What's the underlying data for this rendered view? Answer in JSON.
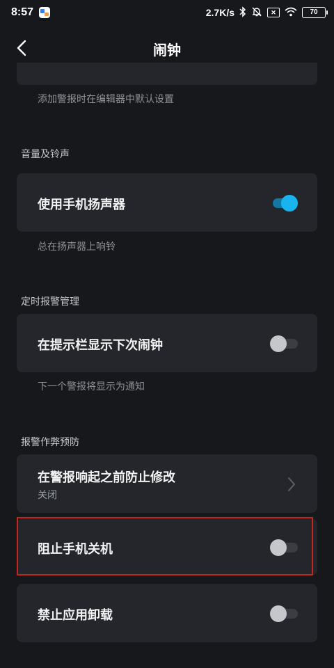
{
  "status_bar": {
    "time": "8:57",
    "network_speed": "2.7K/s",
    "battery": "70",
    "icons": [
      "app-icon",
      "bluetooth-icon",
      "mute-bell-icon",
      "sim-off-icon",
      "wifi-icon",
      "battery-icon"
    ]
  },
  "header": {
    "title": "闹钟",
    "back_icon": "chevron-left-icon"
  },
  "top_hint": "添加警报时在编辑器中默认设置",
  "sections": [
    {
      "title": "音量及铃声",
      "rows": [
        {
          "label": "使用手机扬声器",
          "hint": "总在扬声器上响铃",
          "toggle": "on"
        }
      ]
    },
    {
      "title": "定时报警管理",
      "rows": [
        {
          "label": "在提示栏显示下次闹钟",
          "hint": "下一个警报将显示为通知",
          "toggle": "off"
        }
      ]
    },
    {
      "title": "报警作弊预防",
      "rows": [
        {
          "label": "在警报响起之前防止修改",
          "sub": "关闭",
          "chevron": "chevron-right-icon"
        },
        {
          "label": "阻止手机关机",
          "toggle": "off",
          "highlighted": true
        },
        {
          "label": "禁止应用卸载",
          "toggle": "off"
        }
      ]
    }
  ],
  "colors": {
    "background": "#17181c",
    "card": "#24262b",
    "accent": "#19b4f0",
    "highlight_border": "#c4271e"
  }
}
